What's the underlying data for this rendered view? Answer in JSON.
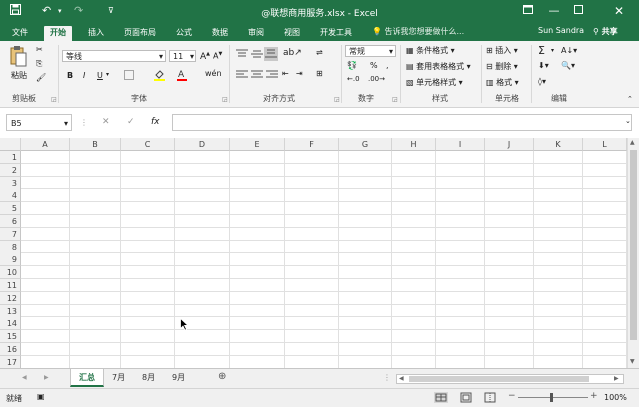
{
  "window": {
    "title": "@联想商用服务.xlsx - Excel"
  },
  "tabs": [
    "文件",
    "开始",
    "插入",
    "页面布局",
    "公式",
    "数据",
    "审阅",
    "视图",
    "开发工具"
  ],
  "active_tab": "开始",
  "tell_me": "告诉我您想要做什么...",
  "user": "Sun Sandra",
  "share": "共享",
  "ribbon": {
    "clipboard": {
      "paste": "粘贴",
      "label": "剪贴板"
    },
    "font": {
      "name": "等线",
      "size": "11",
      "label": "字体",
      "bold": "B",
      "italic": "I",
      "underline": "U"
    },
    "alignment": {
      "label": "对齐方式"
    },
    "number": {
      "format": "常规",
      "percent": "%",
      "comma": ",",
      "label": "数字"
    },
    "styles": {
      "conditional": "条件格式",
      "table": "套用表格格式",
      "cell": "单元格样式",
      "label": "样式"
    },
    "cells": {
      "insert": "插入",
      "delete": "删除",
      "format": "格式",
      "label": "单元格"
    },
    "editing": {
      "label": "编辑"
    }
  },
  "name_box": "B5",
  "fx": "fx",
  "columns": [
    "A",
    "B",
    "C",
    "D",
    "E",
    "F",
    "G",
    "H",
    "I",
    "J",
    "K",
    "L"
  ],
  "rows": [
    "1",
    "2",
    "3",
    "4",
    "5",
    "6",
    "7",
    "8",
    "9",
    "10",
    "11",
    "12",
    "13",
    "14",
    "15",
    "16",
    "17"
  ],
  "sheets": [
    "汇总",
    "7月",
    "8月",
    "9月"
  ],
  "active_sheet": "汇总",
  "status": {
    "ready": "就绪",
    "zoom": "100%"
  }
}
